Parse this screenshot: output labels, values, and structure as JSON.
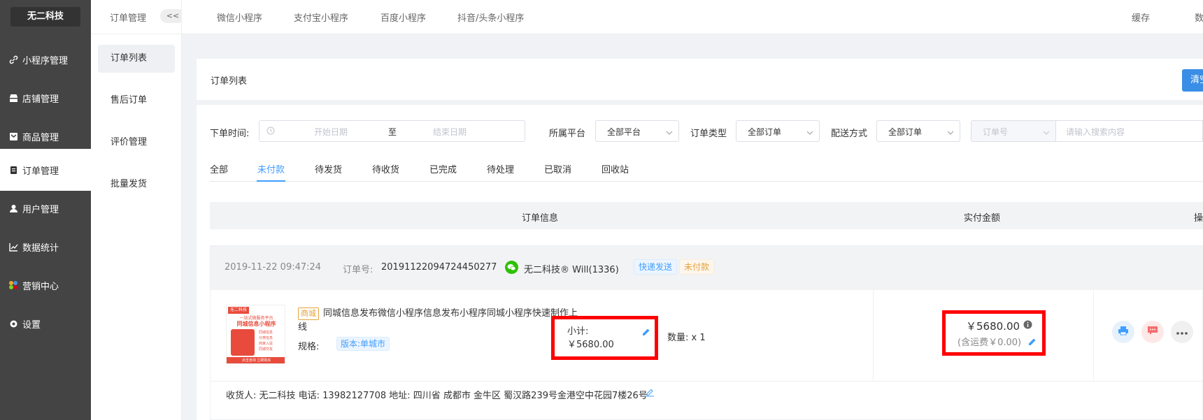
{
  "sidebar": {
    "brand": "无二科技",
    "items": [
      {
        "label": "小程序管理",
        "icon": "link-icon"
      },
      {
        "label": "店铺管理",
        "icon": "shop-icon"
      },
      {
        "label": "商品管理",
        "icon": "goods-icon"
      },
      {
        "label": "订单管理",
        "icon": "order-icon"
      },
      {
        "label": "用户管理",
        "icon": "user-icon"
      },
      {
        "label": "数据统计",
        "icon": "chart-icon"
      },
      {
        "label": "营销中心",
        "icon": "marketing-icon"
      },
      {
        "label": "设置",
        "icon": "settings-icon"
      }
    ]
  },
  "subsidebar": {
    "title": "订单管理",
    "collapse": "<<",
    "items": [
      "订单列表",
      "售后订单",
      "评价管理",
      "批量发货"
    ]
  },
  "topbar": {
    "tabs": [
      "微信小程序",
      "支付宝小程序",
      "百度小程序",
      "抖音/头条小程序"
    ],
    "right": [
      "缓存",
      "数"
    ]
  },
  "card": {
    "title": "订单列表",
    "primary_button": "清空"
  },
  "filters": {
    "order_time_label": "下单时间:",
    "start_placeholder": "开始日期",
    "range_sep": "至",
    "end_placeholder": "结束日期",
    "platform_label": "所属平台",
    "platform_value": "全部平台",
    "order_type_label": "订单类型",
    "order_type_value": "全部订单",
    "delivery_label": "配送方式",
    "delivery_value": "全部订单",
    "search_field_value": "订单号",
    "search_placeholder": "请输入搜索内容"
  },
  "status_tabs": [
    "全部",
    "未付款",
    "待发货",
    "待收货",
    "已完成",
    "待处理",
    "已取消",
    "回收站"
  ],
  "table_header": {
    "order_info": "订单信息",
    "paid_amount": "实付金额",
    "action": "操"
  },
  "order": {
    "time": "2019-11-22 09:47:24",
    "order_no_label": "订单号:",
    "order_no": "20191122094724450277",
    "buyer": "无二科技® Will(1336)",
    "tag_delivery": "快递发送",
    "tag_status": "未付款",
    "shop_tag": "商城",
    "product_title": "同城信息发布微信小程序信息发布小程序同城小程序快速制作上线",
    "spec_label": "规格:",
    "spec_value": "版本:单城市",
    "subtotal_label": "小计:",
    "subtotal_value": "￥5680.00",
    "quantity": "数量: x 1",
    "amount": "￥5680.00",
    "shipping": "(含运费￥0.00)",
    "address": "收货人: 无二科技 电话: 13982127708 地址: 四川省 成都市 金牛区 蜀汉路239号金港空中花园7楼26号",
    "thumb_brand": "无二科技",
    "thumb_line1": "一站式微服务平台",
    "thumb_line2": "同城信息小程序",
    "thumb_features": [
      "同城信息",
      "分类信息",
      "商家入驻",
      "同城交友"
    ],
    "thumb_cta": "点击咨询 立即购买"
  },
  "colors": {
    "sidebar_bg": "#444444",
    "primary": "#409eff",
    "highlight_box": "#ff0000",
    "tag_orange": "#e6a23c"
  }
}
